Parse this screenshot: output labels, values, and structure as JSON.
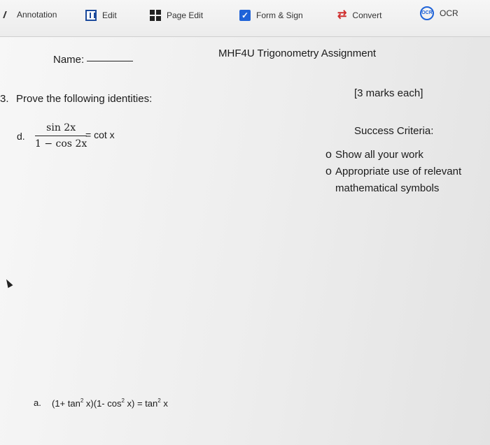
{
  "toolbar": {
    "annotation": "Annotation",
    "edit": "Edit",
    "page_edit": "Page Edit",
    "form_sign": "Form & Sign",
    "convert": "Convert",
    "ocr": "OCR",
    "ocr_badge": "OCR",
    "check_glyph": "✓",
    "convert_glyph": "⇄"
  },
  "document": {
    "name_label": "Name:",
    "title": "MHF4U Trigonometry Assignment",
    "question_number": "3.",
    "question_text": "Prove the following identities:",
    "marks": "[3 marks each]",
    "part_d_label": "d.",
    "part_d_numerator": "sin 2x",
    "part_d_denominator": "1 − cos 2x",
    "part_d_rhs": "= cot x",
    "criteria_title": "Success Criteria:",
    "criteria": [
      "Show all your work",
      "Appropriate use of relevant",
      "mathematical symbols"
    ],
    "bullet_glyph": "o",
    "part_a_label": "a.",
    "part_a_expr_1": "(1+ tan",
    "part_a_expr_2": " x)(1- cos",
    "part_a_expr_3": " x) = tan",
    "part_a_expr_4": " x",
    "exponent": "2"
  },
  "icons": [
    "annotation-icon",
    "edit-icon",
    "page-edit-icon",
    "form-sign-icon",
    "convert-icon",
    "ocr-icon",
    "mouse-cursor-icon"
  ]
}
